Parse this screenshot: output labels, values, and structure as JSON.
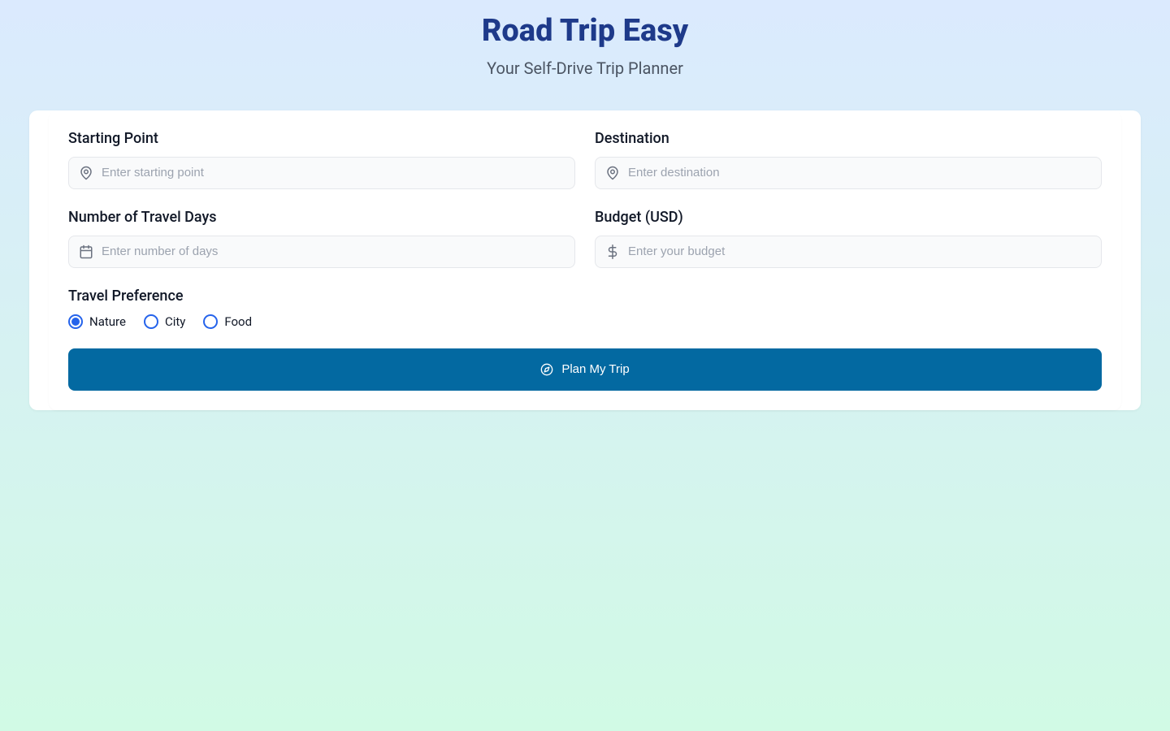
{
  "header": {
    "title": "Road Trip Easy",
    "subtitle": "Your Self-Drive Trip Planner"
  },
  "form": {
    "starting_point": {
      "label": "Starting Point",
      "placeholder": "Enter starting point",
      "value": ""
    },
    "destination": {
      "label": "Destination",
      "placeholder": "Enter destination",
      "value": ""
    },
    "days": {
      "label": "Number of Travel Days",
      "placeholder": "Enter number of days",
      "value": ""
    },
    "budget": {
      "label": "Budget (USD)",
      "placeholder": "Enter your budget",
      "value": ""
    },
    "preference": {
      "label": "Travel Preference",
      "options": [
        {
          "label": "Nature",
          "selected": true
        },
        {
          "label": "City",
          "selected": false
        },
        {
          "label": "Food",
          "selected": false
        }
      ]
    },
    "submit_label": "Plan My Trip"
  },
  "colors": {
    "brand": "#1e3a8a",
    "accent": "#2563eb",
    "button": "#0369a1"
  }
}
